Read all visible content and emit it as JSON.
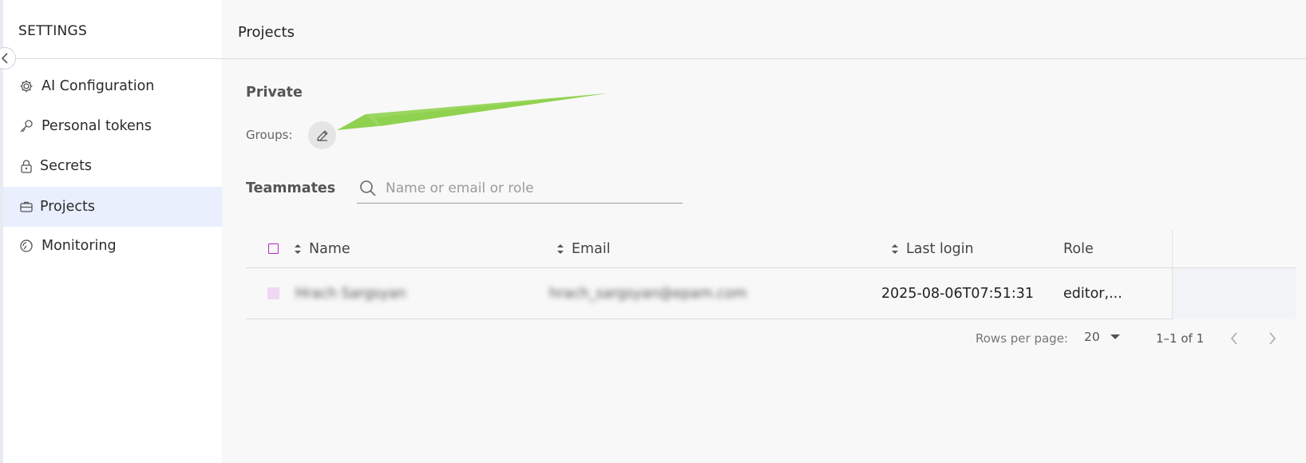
{
  "sidebar": {
    "title": "SETTINGS",
    "items": [
      {
        "label": "AI Configuration",
        "icon": "gear-icon"
      },
      {
        "label": "Personal tokens",
        "icon": "key-icon"
      },
      {
        "label": "Secrets",
        "icon": "lock-icon"
      },
      {
        "label": "Projects",
        "icon": "briefcase-icon",
        "active": true
      },
      {
        "label": "Monitoring",
        "icon": "monitoring-icon"
      }
    ]
  },
  "header": {
    "title": "Projects"
  },
  "project": {
    "name": "Private",
    "groups_label": "Groups:"
  },
  "teammates": {
    "label": "Teammates",
    "search_placeholder": "Name or email or role"
  },
  "table": {
    "columns": {
      "name": "Name",
      "email": "Email",
      "last_login": "Last login",
      "role": "Role"
    },
    "rows": [
      {
        "name": "Hrach Sargsyan",
        "email": "hrach_sargsyan@epam.com",
        "last_login": "2025-08-06T07:51:31",
        "role": "editor,..."
      }
    ]
  },
  "pagination": {
    "rows_per_page_label": "Rows per page:",
    "rows_per_page": "20",
    "range": "1–1 of 1"
  },
  "colors": {
    "accent_checkbox": "#b52bc8",
    "active_nav_bg": "#e9effd",
    "annotation_arrow": "#8fd14f"
  }
}
